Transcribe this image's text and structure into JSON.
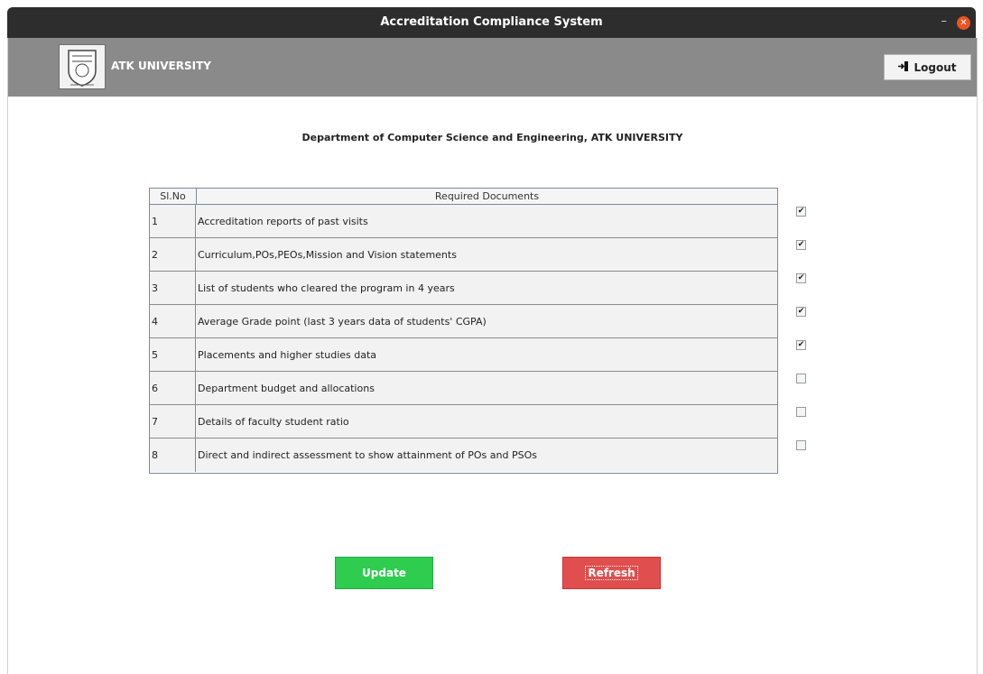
{
  "window": {
    "title": "Accreditation Compliance System"
  },
  "header": {
    "org_name": "ATK UNIVERSITY",
    "logout_label": "Logout"
  },
  "department_title": "Department of Computer Science and Engineering, ATK UNIVERSITY",
  "table": {
    "headers": [
      "Sl.No",
      "Required Documents"
    ],
    "rows": [
      {
        "sl": "1",
        "doc": "Accreditation reports of past visits",
        "checked": true
      },
      {
        "sl": "2",
        "doc": "Curriculum,POs,PEOs,Mission and Vision statements",
        "checked": true
      },
      {
        "sl": "3",
        "doc": "List of students who cleared the program in 4 years",
        "checked": true
      },
      {
        "sl": "4",
        "doc": "Average Grade point (last 3 years data of students' CGPA)",
        "checked": true
      },
      {
        "sl": "5",
        "doc": "Placements and higher studies data",
        "checked": true
      },
      {
        "sl": "6",
        "doc": "Department budget and allocations",
        "checked": false
      },
      {
        "sl": "7",
        "doc": "Details of faculty student ratio",
        "checked": false
      },
      {
        "sl": "8",
        "doc": "Direct and indirect assessment to show attainment of POs and PSOs",
        "checked": false
      }
    ]
  },
  "buttons": {
    "update_label": "Update",
    "refresh_label": "Refresh"
  },
  "colors": {
    "update": "#2ecc4f",
    "refresh": "#e04e4e",
    "header": "#8a8a8a",
    "titlebar": "#2d2d2d"
  }
}
